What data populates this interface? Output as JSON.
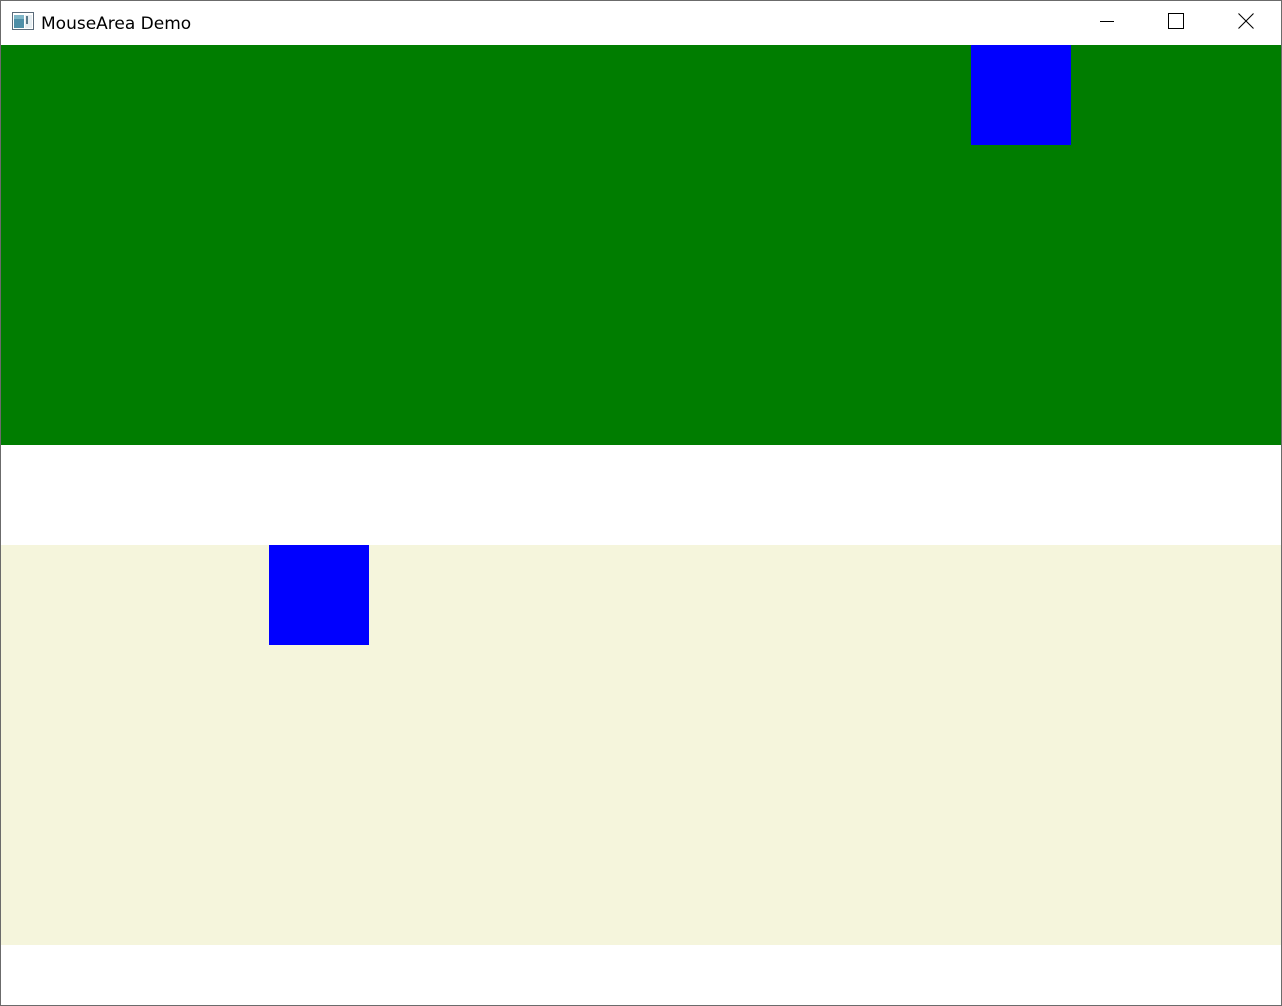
{
  "window": {
    "title": "MouseArea Demo",
    "icon": "app-window-icon",
    "controls": {
      "minimize": "minimize-icon",
      "maximize": "maximize-icon",
      "close": "close-icon"
    }
  },
  "colors": {
    "top_area": "#007d00",
    "bottom_area": "#f5f5dc",
    "square": "#0000ff",
    "background": "#ffffff"
  },
  "areas": [
    {
      "name": "top-mouse-area",
      "color": "#007d00"
    },
    {
      "name": "bottom-mouse-area",
      "color": "#f5f5dc"
    }
  ]
}
